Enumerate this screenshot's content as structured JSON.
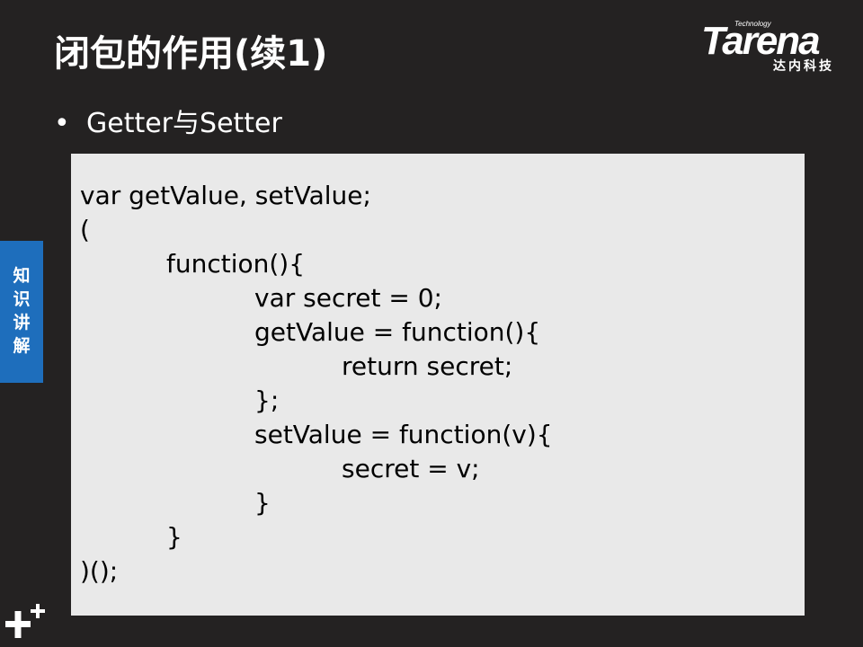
{
  "slide": {
    "title": "闭包的作用(续1)",
    "bullet_symbol": "•",
    "bullet_text": "Getter与Setter"
  },
  "logo": {
    "tagline": "Technology",
    "brand": "Tarena",
    "chinese_name": "达内科技"
  },
  "sidebar": {
    "label": "知\n识\n讲\n解"
  },
  "code": {
    "lines": [
      "var getValue, setValue;",
      "(",
      "function(){",
      "var secret = 0;",
      "getValue = function(){",
      "return secret;",
      "};",
      "setValue = function(v){",
      "secret = v;",
      "}",
      "}",
      ")();"
    ]
  },
  "decor": {
    "corner_icon": "plus-icon"
  },
  "colors": {
    "background": "#242222",
    "code_background": "#e9e9e9",
    "sidebar_accent": "#1e6ebc",
    "text": "#ffffff",
    "code_text": "#000000"
  }
}
